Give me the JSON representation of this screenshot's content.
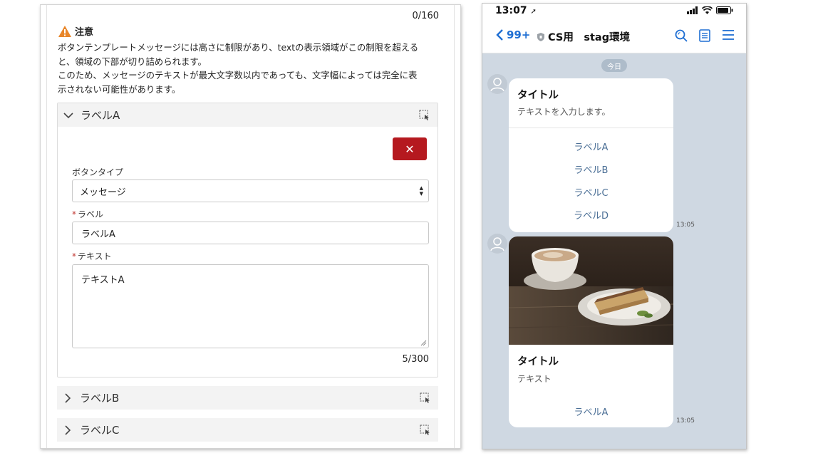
{
  "editor": {
    "top_counter": "0/160",
    "notice": {
      "title": "注意",
      "lines": [
        "ボタンテンプレートメッセージには高さに制限があり、textの表示領域がこの制限を超える",
        "と、領域の下部が切り詰められます。",
        "このため、メッセージのテキストが最大文字数以内であっても、文字幅によっては完全に表",
        "示されない可能性があります。"
      ]
    },
    "actions": [
      {
        "header_label": "ラベルA",
        "delete_label": "✕",
        "button_type_label": "ボタンタイプ",
        "button_type_value": "メッセージ",
        "label_field_label": "ラベル",
        "label_value": "ラベルA",
        "text_field_label": "テキスト",
        "text_value": "テキストA",
        "text_counter": "5/300",
        "required_mark": "*"
      },
      {
        "header_label": "ラベルB"
      },
      {
        "header_label": "ラベルC"
      }
    ]
  },
  "phone": {
    "status_time": "13:07",
    "nav": {
      "back_count": "99+",
      "chat_title": "CS用　stag環境"
    },
    "date_pill": "今日",
    "messages": [
      {
        "title": "タイトル",
        "text": "テキストを入力します。",
        "buttons": [
          "ラベルA",
          "ラベルB",
          "ラベルC",
          "ラベルD"
        ],
        "time": "13:05"
      },
      {
        "title": "タイトル",
        "text": "テキスト",
        "buttons": [
          "ラベルA"
        ],
        "time": "13:05"
      }
    ]
  },
  "colors": {
    "delete_red": "#b5191f",
    "link_blue": "#1f6fd3",
    "chat_bg": "#cfd8e2",
    "warning_orange": "#e8862a",
    "button_text": "#4b6f96"
  },
  "icons": [
    "warning-icon",
    "chevron-down-icon",
    "chevron-right-icon",
    "drag-handle-icon",
    "close-icon",
    "search-icon",
    "notes-icon",
    "menu-icon",
    "back-chevron-icon",
    "shield-icon"
  ]
}
